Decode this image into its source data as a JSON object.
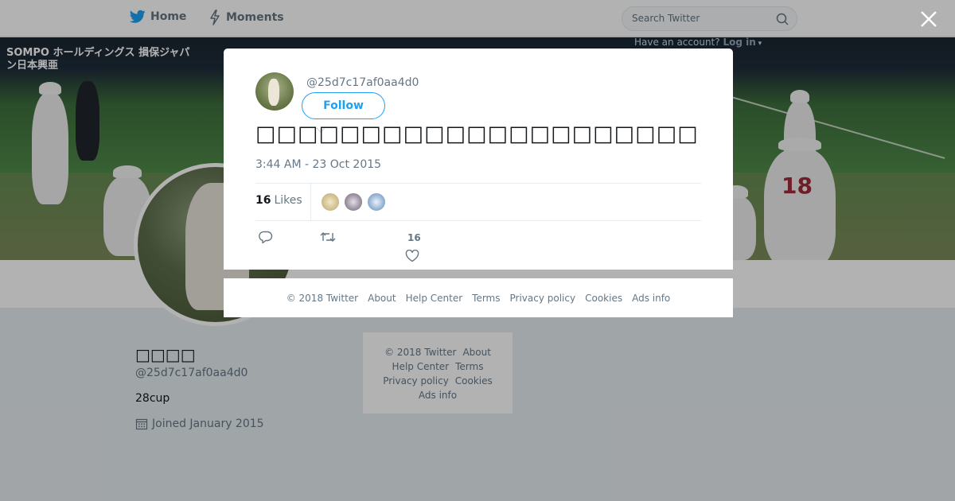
{
  "nav": {
    "home_label": "Home",
    "moments_label": "Moments",
    "search_placeholder": "Search Twitter",
    "account_prompt": "Have an account?",
    "login_label": "Log in"
  },
  "banner": {
    "sign_text": "SOMPO ホールディングス 損保ジャパン日本興亜",
    "player_number": "18"
  },
  "profile": {
    "name": "□□□□",
    "handle": "@25d7c17af0aa4d0",
    "bio": "28cup",
    "joined": "Joined January 2015"
  },
  "side_footer": {
    "links": [
      "© 2018 Twitter",
      "About",
      "Help Center",
      "Terms",
      "Privacy policy",
      "Cookies",
      "Ads info"
    ]
  },
  "tweet": {
    "handle": "@25d7c17af0aa4d0",
    "follow_label": "Follow",
    "text": "□□□□□□□□□□□□□□□□□□□□□",
    "timestamp": "3:44 AM - 23 Oct 2015",
    "likes_count": "16",
    "likes_label": "Likes",
    "like_action_count": "16"
  },
  "modal_footer": {
    "links": [
      "© 2018 Twitter",
      "About",
      "Help Center",
      "Terms",
      "Privacy policy",
      "Cookies",
      "Ads info"
    ]
  },
  "colors": {
    "accent": "#1da1f2",
    "muted": "#657786",
    "background": "#e6ecf0"
  }
}
